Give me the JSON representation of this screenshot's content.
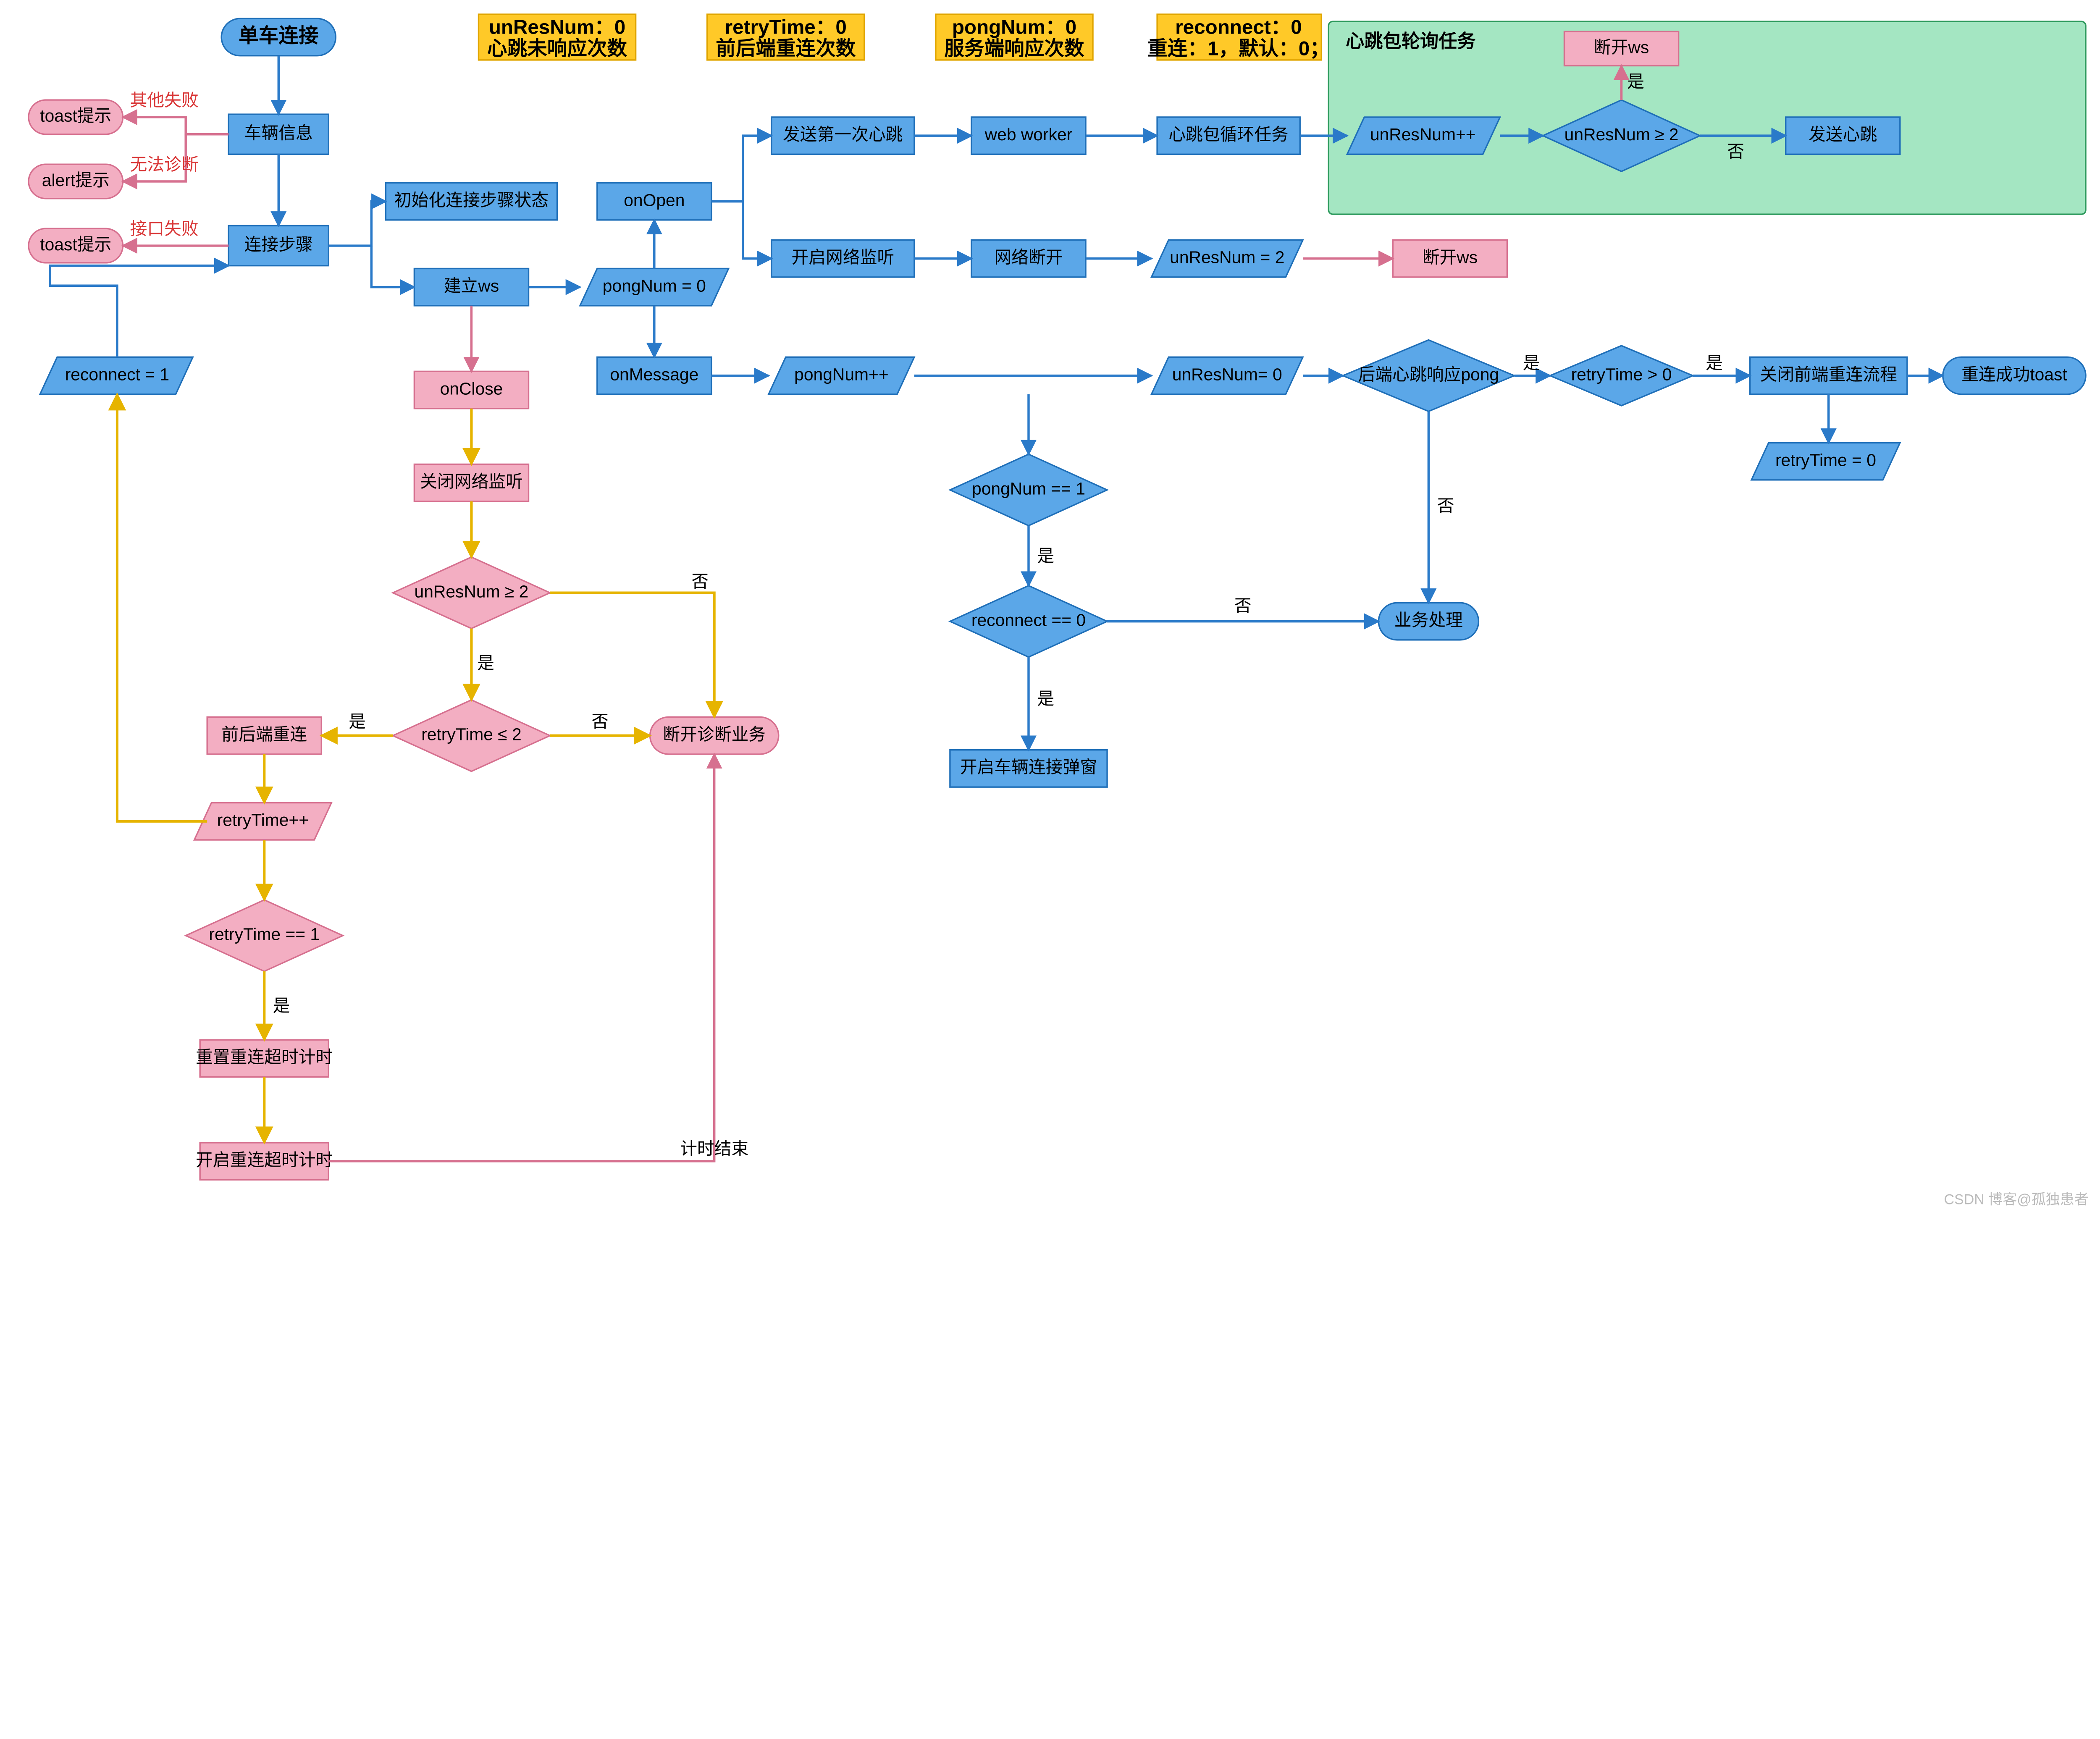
{
  "colors": {
    "blueFill": "#5ba7e8",
    "blueStroke": "#1f6fb8",
    "pinkFill": "#f3aec2",
    "pinkStroke": "#d6708f",
    "yellowFill": "#ffc928",
    "yellowStroke": "#e0a500",
    "greenFill": "#a4e6c2",
    "greenStroke": "#2e9a5d",
    "lineBlue": "#2a7ac9",
    "linePink": "#d6708f",
    "lineYellow": "#e6b400"
  },
  "group": {
    "title": "心跳包轮询任务"
  },
  "badges": {
    "b1": {
      "l1": "unResNum：0",
      "l2": "心跳未响应次数"
    },
    "b2": {
      "l1": "retryTime：0",
      "l2": "前后端重连次数"
    },
    "b3": {
      "l1": "pongNum：0",
      "l2": "服务端响应次数"
    },
    "b4": {
      "l1": "reconnect：0",
      "l2": "重连：1，默认：0；"
    }
  },
  "nodes": {
    "start": "单车连接",
    "vehInfo": "车辆信息",
    "connStep": "连接步骤",
    "initStep": "初始化连接步骤状态",
    "buildWs": "建立ws",
    "pongZero": "pongNum = 0",
    "onOpen": "onOpen",
    "onMsg": "onMessage",
    "sendFirst": "发送第一次心跳",
    "webWorker": "web worker",
    "heartLoop": "心跳包循环任务",
    "startNet": "开启网络监听",
    "netOff": "网络断开",
    "unRes2": "unResNum = 2",
    "discWs2": "断开ws",
    "unResInc": "unResNum++",
    "unResGe2": "unResNum ≥ 2",
    "sendHeart": "发送心跳",
    "discWs1": "断开ws",
    "pongInc": "pongNum++",
    "unResZero": "unResNum= 0",
    "backPong": "后端心跳响应pong",
    "retryGt0": "retryTime > 0",
    "closeFront": "关闭前端重连流程",
    "reconnOk": "重连成功toast",
    "retryZero": "retryTime = 0",
    "pongEq1": "pongNum == 1",
    "reconnEq0": "reconnect == 0",
    "openPop": "开启车辆连接弹窗",
    "biz": "业务处理",
    "onClose": "onClose",
    "closeNet": "关闭网络监听",
    "unResGe2b": "unResNum ≥ 2",
    "retryLe2": "retryTime ≤ 2",
    "feReconn": "前后端重连",
    "retryInc": "retryTime++",
    "retryEq1": "retryTime == 1",
    "resetTimer": "重置重连超时计时",
    "startTimer": "开启重连超时计时",
    "discDiag": "断开诊断业务",
    "reconnSet": "reconnect = 1",
    "toast1": "toast提示",
    "alert1": "alert提示",
    "toast2": "toast提示"
  },
  "edges": {
    "otherFail": "其他失败",
    "noDiag": "无法诊断",
    "apiFail": "接口失败",
    "yes": "是",
    "no": "否",
    "timerEnd": "计时结束"
  },
  "watermark": "CSDN 博客@孤独患者"
}
